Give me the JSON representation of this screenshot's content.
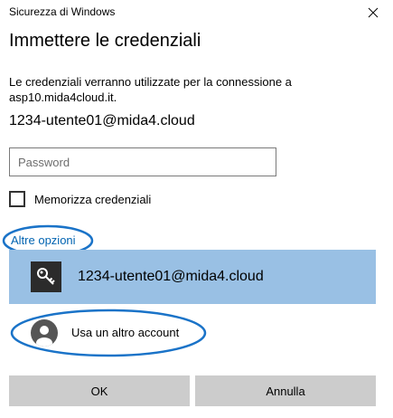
{
  "window": {
    "title": "Sicurezza di Windows",
    "close_icon": "close-icon"
  },
  "dialog": {
    "heading": "Immettere le credenziali",
    "description": "Le credenziali verranno utilizzate per la connessione a asp10.mida4cloud.it.",
    "account_name": "1234-utente01@mida4.cloud"
  },
  "password": {
    "placeholder": "Password",
    "value": ""
  },
  "remember": {
    "label": "Memorizza credenziali",
    "checked": false
  },
  "more_options": {
    "label": "Altre opzioni"
  },
  "accounts": {
    "selected": {
      "label": "1234-utente01@mida4.cloud",
      "icon": "key-icon"
    },
    "other": {
      "label": "Usa un altro account",
      "icon": "user-avatar-icon"
    }
  },
  "buttons": {
    "ok": "OK",
    "cancel": "Annulla"
  },
  "colors": {
    "accent": "#0063b1",
    "tile_selected": "#99c0e4",
    "annotation": "#1a73c8",
    "button": "#cccccc"
  }
}
